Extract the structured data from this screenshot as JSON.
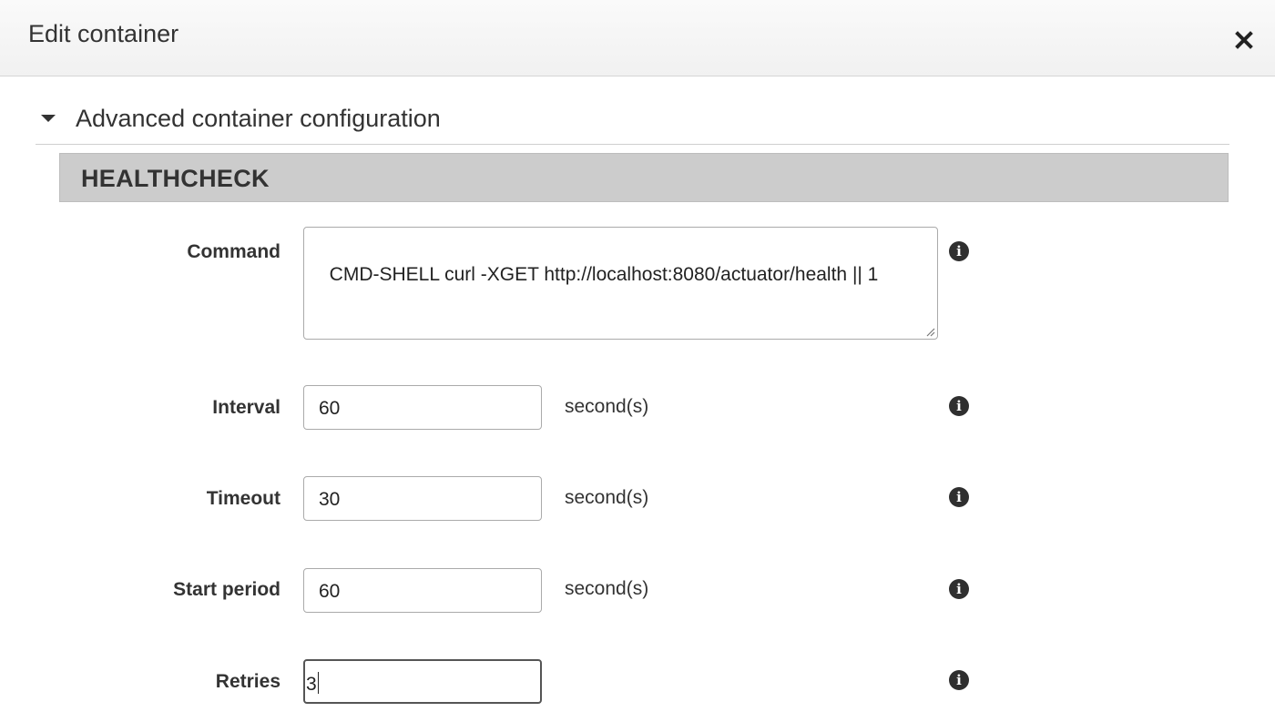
{
  "dialog": {
    "title": "Edit container",
    "close_icon": "close-icon"
  },
  "section": {
    "label": "Advanced container configuration",
    "toggle_icon": "caret-down-icon",
    "expanded": true
  },
  "healthcheck": {
    "heading": "HEALTHCHECK",
    "info_icon": "info-icon",
    "info_glyph": "i",
    "command": {
      "label": "Command",
      "value": "CMD-SHELL curl -XGET http://localhost:8080/actuator/health || 1"
    },
    "interval": {
      "label": "Interval",
      "value": "60",
      "unit": "second(s)"
    },
    "timeout": {
      "label": "Timeout",
      "value": "30",
      "unit": "second(s)"
    },
    "start_period": {
      "label": "Start period",
      "value": "60",
      "unit": "second(s)"
    },
    "retries": {
      "label": "Retries",
      "value": "3"
    }
  },
  "colors": {
    "header_bg": "#f1f1f1",
    "subsection_bg": "#cccccc",
    "text": "#333333",
    "focus_border": "#555555"
  }
}
